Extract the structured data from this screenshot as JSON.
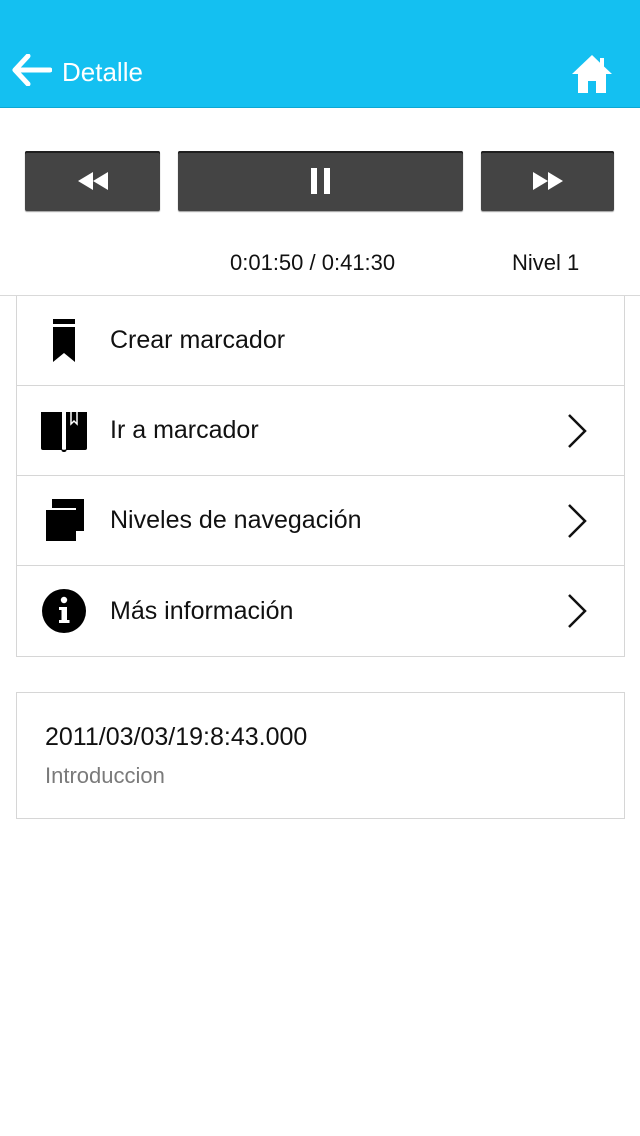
{
  "header": {
    "back_label": "Detalle",
    "back_icon": "arrow-left-icon",
    "home_icon": "home-icon",
    "bg_color": "#14c0f1"
  },
  "player": {
    "rewind_icon": "rewind-icon",
    "pause_icon": "pause-icon",
    "forward_icon": "fast-forward-icon",
    "time": "0:01:50 / 0:41:30",
    "level": "Nivel 1",
    "button_color": "#444444"
  },
  "menu": {
    "items": [
      {
        "label": "Crear marcador",
        "icon": "bookmark-icon",
        "has_chevron": false
      },
      {
        "label": "Ir a marcador",
        "icon": "book-bookmark-icon",
        "has_chevron": true
      },
      {
        "label": "Niveles de navegación",
        "icon": "layers-icon",
        "has_chevron": true
      },
      {
        "label": "Más información",
        "icon": "info-icon",
        "has_chevron": true
      }
    ]
  },
  "card": {
    "title": "2011/03/03/19:8:43.000",
    "subtitle": "Introduccion"
  }
}
